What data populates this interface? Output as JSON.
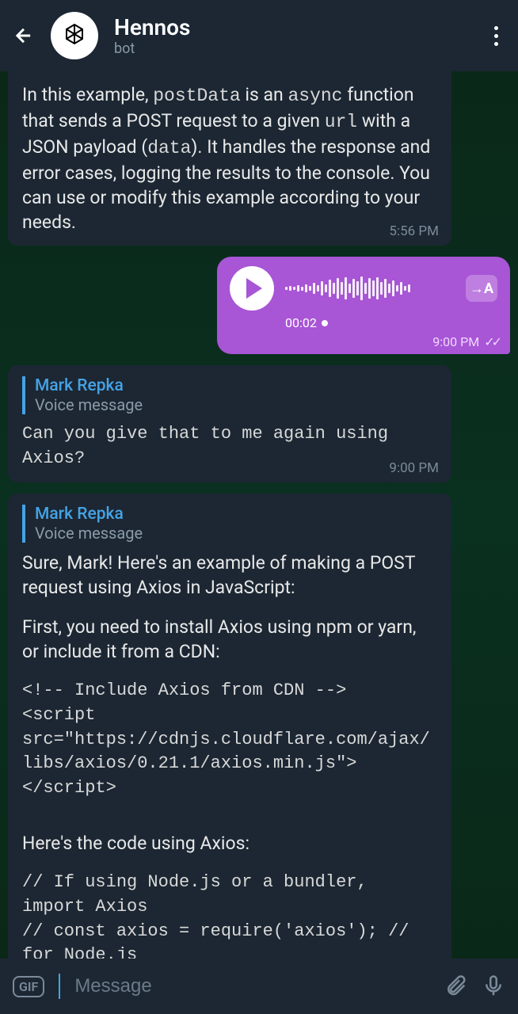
{
  "header": {
    "title": "Hennos",
    "subtitle": "bot"
  },
  "messages": {
    "m1": {
      "pre": "In this example, ",
      "code1": "postData",
      "mid1": " is an ",
      "code2": "async",
      "mid2": " function that sends a POST request to a given ",
      "code3": "url",
      "mid3": " with a JSON payload (",
      "code4": "data",
      "post": "). It handles the response and error cases, logging the results to the console. You can use or modify this example according to your needs.",
      "time": "5:56 PM"
    },
    "voice": {
      "duration": "00:02",
      "time": "9:00 PM",
      "tx_label": "→A"
    },
    "m2": {
      "reply_name": "Mark Repka",
      "reply_sub": "Voice message",
      "text": "Can you give that to me again using Axios?",
      "time": "9:00 PM"
    },
    "m3": {
      "reply_name": "Mark Repka",
      "reply_sub": "Voice message",
      "p1": "Sure, Mark! Here's an example of making a POST request using Axios in JavaScript:",
      "p2": "First, you need to install Axios using npm or yarn, or include it from a CDN:",
      "code1": "<!-- Include Axios from CDN -->\n<script src=\"https://cdnjs.cloudflare.com/ajax/libs/axios/0.21.1/axios.min.js\"></script>",
      "p3": "Here's the code using Axios:",
      "code2": "// If using Node.js or a bundler, import Axios\n// const axios = require('axios'); // for Node.js\n// import axios from 'axios'; // for"
    }
  },
  "input": {
    "placeholder": "Message"
  }
}
